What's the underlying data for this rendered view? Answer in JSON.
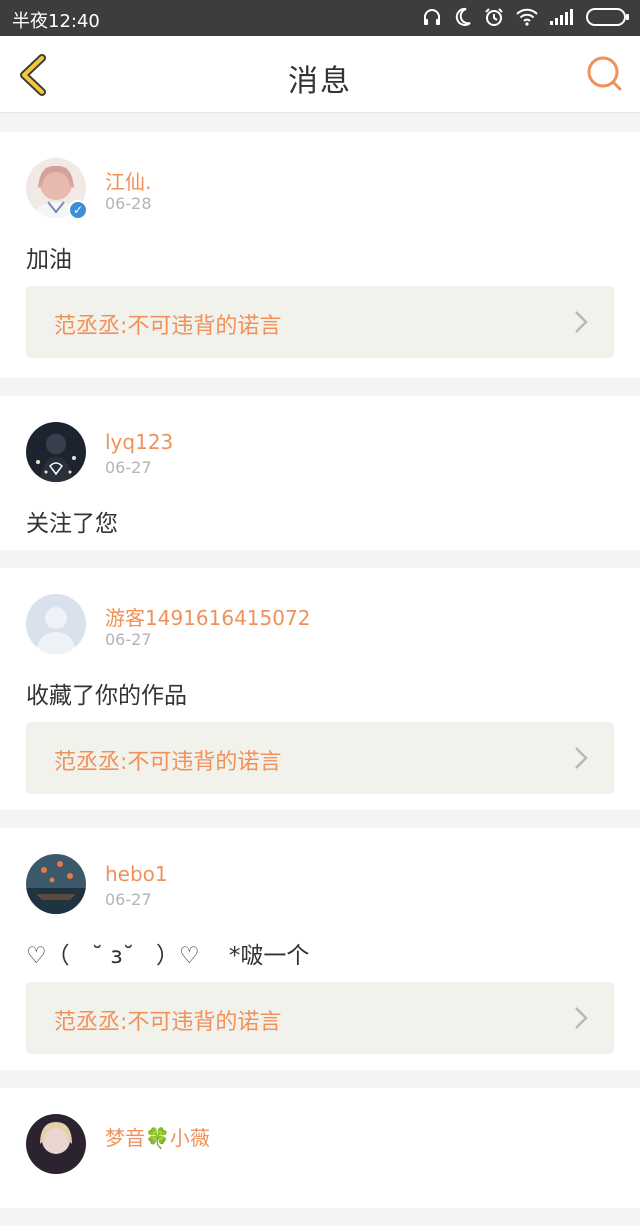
{
  "status_bar": {
    "time": "半夜12:40"
  },
  "header": {
    "title": "消息"
  },
  "messages": [
    {
      "username": "江仙.",
      "date": "06-28",
      "content": "加油",
      "ref": "范丞丞:不可违背的诺言",
      "verified": true
    },
    {
      "username": "lyq123",
      "date": "06-27",
      "content": "关注了您"
    },
    {
      "username": "游客1491616415072",
      "date": "06-27",
      "content": "收藏了你的作品",
      "ref": "范丞丞:不可违背的诺言"
    },
    {
      "username": "hebo1",
      "date": "06-27",
      "content": "♡（   ˘ з˘   ）♡    *啵一个",
      "ref": "范丞丞:不可违背的诺言"
    },
    {
      "username": "梦音🍀小薇",
      "date": "",
      "content": ""
    }
  ]
}
